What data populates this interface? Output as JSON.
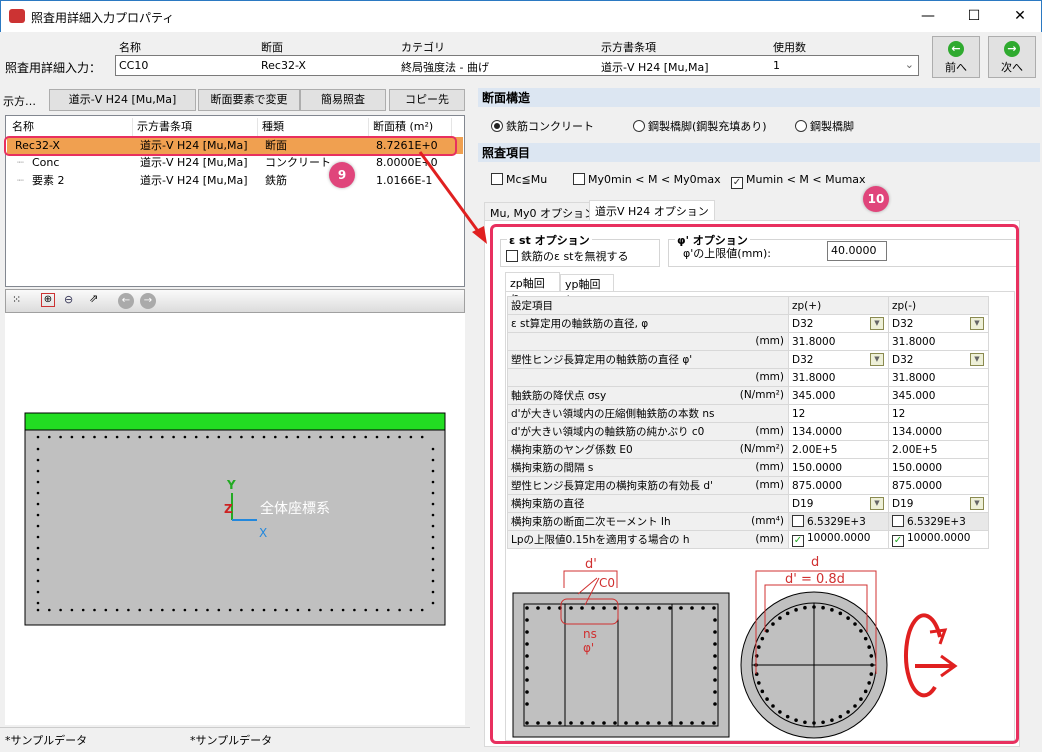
{
  "window": {
    "title": "照査用詳細入力プロパティ",
    "min": "—",
    "max": "☐",
    "close": "✕"
  },
  "header": {
    "label": "照査用詳細入力：",
    "columns": [
      "名称",
      "断面",
      "カテゴリ",
      "示方書条項",
      "使用数"
    ],
    "values": [
      "CC10",
      "Rec32-X",
      "終局強度法 - 曲げ",
      "道示-V H24 [Mu,Ma]",
      "1"
    ],
    "prev": "前へ",
    "next": "次へ"
  },
  "left": {
    "toolbar_label": "示方…",
    "buttons": [
      "道示-V H24 [Mu,Ma]",
      "断面要素で変更",
      "簡易照査",
      "コピー先"
    ],
    "list_headers": [
      "名称",
      "示方書条項",
      "種類",
      "断面積 (m²)"
    ],
    "rows": [
      {
        "name": "Rec32-X",
        "code": "道示-V H24 [Mu,Ma]",
        "type": "断面",
        "area": "8.7261E+0"
      },
      {
        "name": "Conc",
        "code": "道示-V H24 [Mu,Ma]",
        "type": "コンクリート",
        "area": "8.0000E+0"
      },
      {
        "name": "要素  2",
        "code": "道示-V H24 [Mu,Ma]",
        "type": "鉄筋",
        "area": "1.0166E-1"
      }
    ],
    "axis": {
      "y": "Y",
      "z": "Z",
      "x": "X",
      "label": "全体座標系"
    },
    "status": [
      "*サンプルデータ",
      "*サンプルデータ"
    ]
  },
  "right": {
    "section_structure": "断面構造",
    "radios": [
      "鉄筋コンクリート",
      "鋼製橋脚(鋼製充填あり)",
      "鋼製橋脚"
    ],
    "check_items": "照査項目",
    "checks": [
      {
        "label": "Mc≦Mu",
        "checked": false
      },
      {
        "label": "My0min < M < My0max",
        "checked": false
      },
      {
        "label": "Mumin < M < Mumax",
        "checked": true
      }
    ],
    "tabs": [
      "Mu, My0 オプション",
      "道示V H24 オプション"
    ],
    "est_group": "ε st オプション",
    "est_check": "鉄筋のε stを無視する",
    "phi_group": "φ' オプション",
    "phi_label": "φ'の上限値(mm):",
    "phi_value": "40.0000",
    "axis_tabs": [
      "zp軸回り",
      "yp軸回り"
    ],
    "table_headers": [
      "設定項目",
      "zp(+)",
      "zp(-)"
    ],
    "table_rows": [
      {
        "label": "ε st算定用の軸鉄筋の直径, φ",
        "unit": "",
        "p": "D32",
        "m": "D32",
        "dd": true
      },
      {
        "label": "",
        "unit": "(mm)",
        "p": "31.8000",
        "m": "31.8000"
      },
      {
        "label": "塑性ヒンジ長算定用の軸鉄筋の直径 φ'",
        "unit": "",
        "p": "D32",
        "m": "D32",
        "dd": true
      },
      {
        "label": "",
        "unit": "(mm)",
        "p": "31.8000",
        "m": "31.8000"
      },
      {
        "label": "軸鉄筋の降伏点 σsy",
        "unit": "(N/mm²)",
        "p": "345.000",
        "m": "345.000"
      },
      {
        "label": "d'が大きい領域内の圧縮側軸鉄筋の本数 ns",
        "unit": "",
        "p": "12",
        "m": "12"
      },
      {
        "label": "d'が大きい領域内の軸鉄筋の純かぶり c0",
        "unit": "(mm)",
        "p": "134.0000",
        "m": "134.0000"
      },
      {
        "label": "横拘束筋のヤング係数 E0",
        "unit": "(N/mm²)",
        "p": "2.00E+5",
        "m": "2.00E+5"
      },
      {
        "label": "横拘束筋の間隔 s",
        "unit": "(mm)",
        "p": "150.0000",
        "m": "150.0000"
      },
      {
        "label": "塑性ヒンジ長算定用の横拘束筋の有効長 d'",
        "unit": "(mm)",
        "p": "875.0000",
        "m": "875.0000"
      },
      {
        "label": "横拘束筋の直径",
        "unit": "",
        "p": "D19",
        "m": "D19",
        "dd": true
      },
      {
        "label": "横拘束筋の断面二次モーメント Ih",
        "unit": "(mm⁴)",
        "p": "6.5329E+3",
        "m": "6.5329E+3",
        "cb": false
      },
      {
        "label": "Lpの上限値0.15hを適用する場合の h",
        "unit": "(mm)",
        "p": "10000.0000",
        "m": "10000.0000",
        "cb": true
      }
    ],
    "diagram": {
      "d_prime": "d'",
      "c0": "C0",
      "ns": "ns",
      "phi": "φ'",
      "d": "d",
      "d_eq": "d' = 0.8d"
    }
  },
  "annotations": {
    "nine": "9",
    "ten": "10"
  },
  "colors": {
    "highlight": "#f0a050",
    "annot": "#e8305f",
    "rebar_red": "#d03030"
  }
}
